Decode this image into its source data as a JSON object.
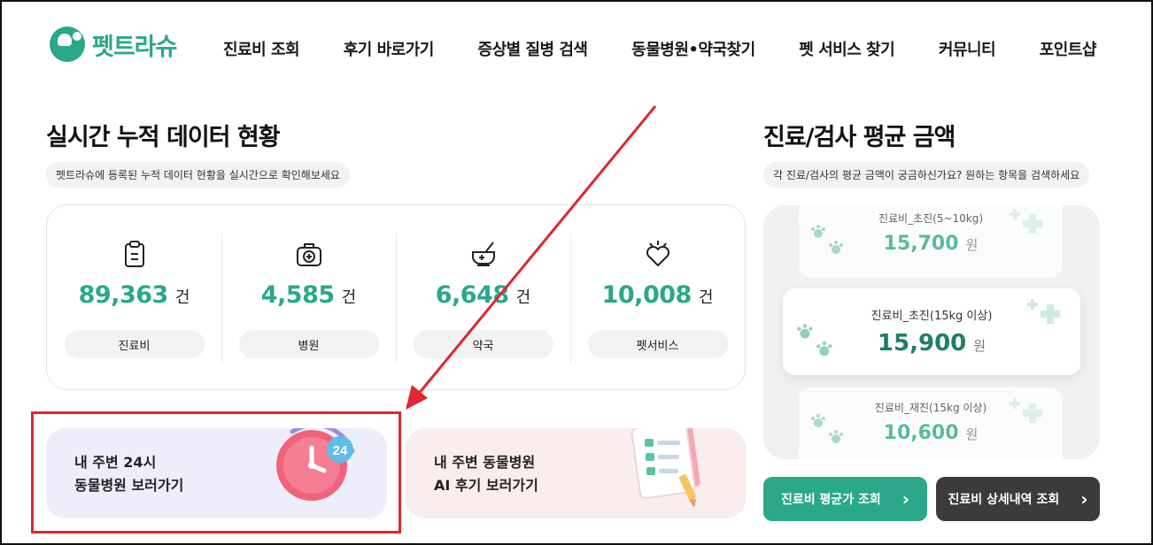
{
  "brand": {
    "name": "펫트라슈"
  },
  "nav": [
    "진료비 조회",
    "후기 바로가기",
    "증상별 질병 검색",
    "동물병원•약국찾기",
    "펫 서비스 찾기",
    "커뮤니티",
    "포인트샵"
  ],
  "stats_section": {
    "title": "실시간 누적 데이터 현황",
    "subtitle": "펫트라슈에 등록된 누적 데이터 현황을 실시간으로 확인해보세요",
    "items": [
      {
        "icon": "clipboard-icon",
        "value": "89,363",
        "unit": "건",
        "label": "진료비"
      },
      {
        "icon": "medical-bag-icon",
        "value": "4,585",
        "unit": "건",
        "label": "병원"
      },
      {
        "icon": "mortar-icon",
        "value": "6,648",
        "unit": "건",
        "label": "약국"
      },
      {
        "icon": "heart-icon",
        "value": "10,008",
        "unit": "건",
        "label": "펫서비스"
      }
    ]
  },
  "promos": [
    {
      "line1": "내 주변 24시",
      "line2": "동물병원 보러가기",
      "badge": "24"
    },
    {
      "line1": "내 주변 동물병원",
      "line2": "AI 후기 보러가기"
    }
  ],
  "price_section": {
    "title": "진료/검사 평균 금액",
    "subtitle": "각 진료/검사의 평균 금액이 궁금하신가요? 원하는 항목을 검색하세요",
    "cards": [
      {
        "label": "진료비_초진(5~10kg)",
        "price": "15,700",
        "unit": "원"
      },
      {
        "label": "진료비_초진(15kg 이상)",
        "price": "15,900",
        "unit": "원"
      },
      {
        "label": "진료비_재진(15kg 이상)",
        "price": "10,600",
        "unit": "원"
      }
    ],
    "buttons": [
      {
        "label": "진료비 평균가 조회",
        "arrow": "›"
      },
      {
        "label": "진료비 상세내역 조회",
        "arrow": "›"
      }
    ]
  },
  "colors": {
    "accent": "#2aa889",
    "annotation": "#e0262e",
    "dark_button": "#3b3b3b"
  }
}
